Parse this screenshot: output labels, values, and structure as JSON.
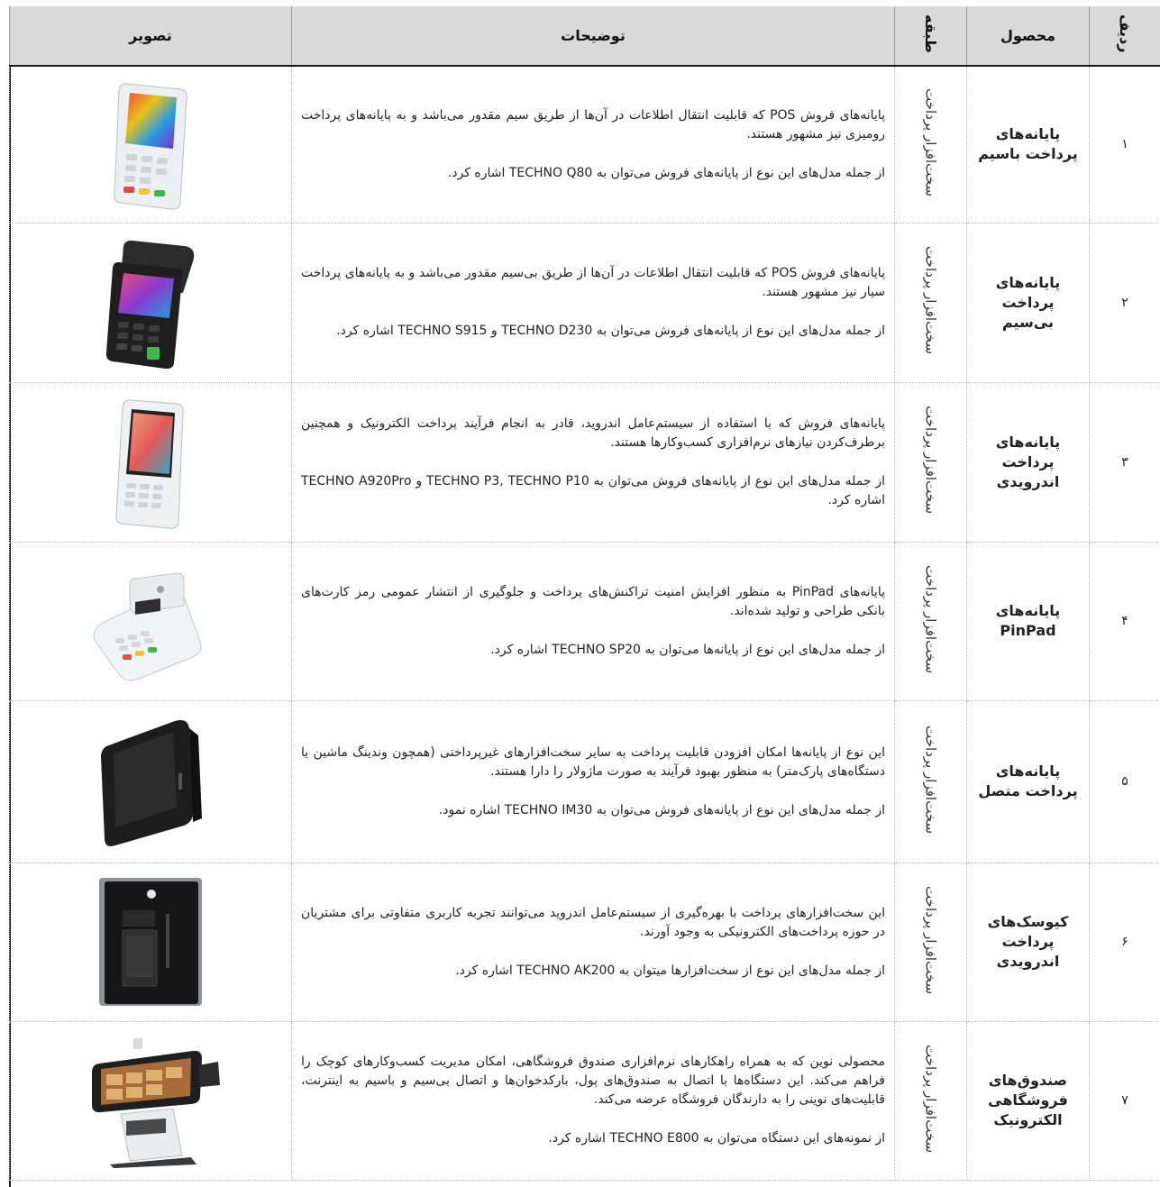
{
  "header": {
    "image": "تصویر",
    "description": "توضیحات",
    "category": "طبقه",
    "product": "محصول",
    "row": "ردیف"
  },
  "rows": [
    {
      "num": "۱",
      "product": "پایانه‌های پرداخت باسیم",
      "category": "سخت‌افزار پرداخت",
      "desc1": "پایانه‌های فروش POS که قابلیت انتقال اطلاعات در آن‌ها از طریق سیم مقدور می‌باشد و به پایانه‌های پرداخت رومیزی نیز مشهور هستند.",
      "desc2": "از جمله مدل‌های این نوع از پایانه‌های فروش می‌توان به TECHNO Q80 اشاره کرد.",
      "icon": "wired-pos-terminal-image"
    },
    {
      "num": "۲",
      "product": "پایانه‌های پرداخت بی‌سیم",
      "category": "سخت‌افزار پرداخت",
      "desc1": "پایانه‌های فروش POS که قابلیت انتقال اطلاعات در آن‌ها از طریق بی‌سیم مقدور می‌باشد و به پایانه‌های پرداخت سیار نیز مشهور هستند.",
      "desc2": "از جمله مدل‌های این نوع از پایانه‌های فروش می‌توان به TECHNO D230 و TECHNO S915 اشاره کرد.",
      "icon": "wireless-pos-terminal-image"
    },
    {
      "num": "۳",
      "product": "پایانه‌های پرداخت اندرویدی",
      "category": "سخت‌افزار پرداخت",
      "desc1": "پایانه‌های فروش که با استفاده از سیستم‌عامل اندروید، قادر به انجام فرآیند پرداخت الکترونیک و همچنین برطرف‌کردن نیازهای نرم‌افزاری کسب‌وکارها هستند.",
      "desc2": "از جمله مدل‌های این نوع از پایانه‌های فروش می‌توان به TECHNO P3, TECHNO P10 و TECHNO A920Pro اشاره کرد.",
      "icon": "android-pos-terminal-image"
    },
    {
      "num": "۴",
      "product": "پایانه‌های PinPad",
      "category": "سخت‌افزار پرداخت",
      "desc1": "پایانه‌های PinPad به منظور افزایش امنیت تراکنش‌های پرداخت و جلوگیری از انتشار عمومی رمز کارت‌های بانکی طراحی و تولید شده‌اند.",
      "desc2": "از جمله مدل‌های این نوع از پایانه‌ها می‌توان به TECHNO SP20 اشاره کرد.",
      "icon": "pinpad-image"
    },
    {
      "num": "۵",
      "product": "پایانه‌های پرداخت متصل",
      "category": "سخت‌افزار پرداخت",
      "desc1": "این نوع از پایانه‌ها امکان افزودن قابلیت پرداخت به سایر سخت‌افزارهای غیرپرداختی (همچون وندینگ ماشین یا دستگاه‌های پارک‌متر) به منظور بهبود فرآیند به صورت ماژولار را دارا هستند.",
      "desc2": "از جمله مدل‌های این نوع از پایانه‌های فروش می‌توان به TECHNO IM30 اشاره نمود.",
      "icon": "integrated-payment-module-image"
    },
    {
      "num": "۶",
      "product": "کیوسک‌های پرداخت اندرویدی",
      "category": "سخت‌افزار پرداخت",
      "desc1": "این سخت‌افزارهای پرداخت با بهره‌گیری از سیستم‌عامل اندروید می‌توانند تجربه کاربری متفاوتی برای مشتریان در حوزه پرداخت‌های الکترونیکی به وجود آورند.",
      "desc2": "از جمله مدل‌های این نوع از سخت‌افزارها میتوان به TECHNO AK200 اشاره کرد.",
      "icon": "android-kiosk-image"
    },
    {
      "num": "۷",
      "product": "صندوق‌های فروشگاهی الکترونیک",
      "category": "سخت‌افزار پرداخت",
      "desc1": "محصولی نوین که به همراه راهکارهای نرم‌افزاری صندوق فروشگاهی، امکان مدیریت کسب‌وکارهای کوچک را فراهم می‌کند. این دستگاه‌ها با اتصال به صندوق‌های پول، بارکدخوان‌ها و اتصال بی‌سیم و باسیم به اینترنت، قابلیت‌های نوینی را به دارندگان فروشگاه عرضه می‌کند.",
      "desc2": "از نمونه‌های این دستگاه می‌توان به TECHNO E800 اشاره کرد.",
      "icon": "electronic-cash-register-image"
    }
  ]
}
